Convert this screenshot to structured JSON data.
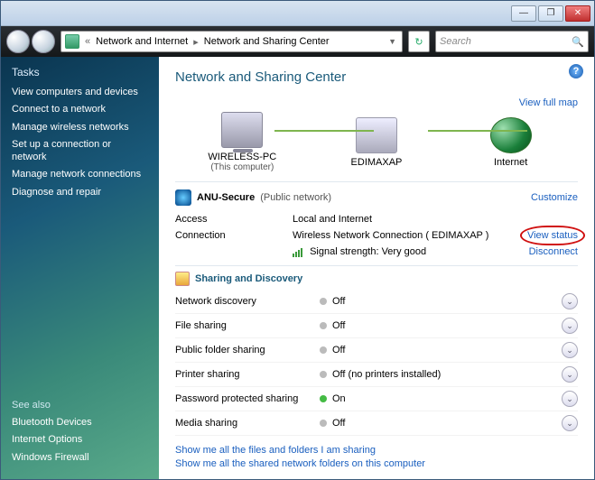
{
  "titlebar": {
    "min": "—",
    "max": "❐",
    "close": "✕"
  },
  "breadcrumb": {
    "prefix": "«",
    "part1": "Network and Internet",
    "part2": "Network and Sharing Center"
  },
  "search": {
    "placeholder": "Search"
  },
  "sidebar": {
    "tasks_head": "Tasks",
    "items": [
      "View computers and devices",
      "Connect to a network",
      "Manage wireless networks",
      "Set up a connection or network",
      "Manage network connections",
      "Diagnose and repair"
    ],
    "seealso_head": "See also",
    "seealso": [
      "Bluetooth Devices",
      "Internet Options",
      "Windows Firewall"
    ]
  },
  "page": {
    "title": "Network and Sharing Center",
    "view_full_map": "View full map",
    "nodes": {
      "pc_name": "WIRELESS-PC",
      "pc_sub": "(This computer)",
      "ap_name": "EDIMAXAP",
      "internet": "Internet"
    }
  },
  "network": {
    "name": "ANU-Secure",
    "type": "(Public network)",
    "customize": "Customize",
    "access_label": "Access",
    "access_value": "Local and Internet",
    "conn_label": "Connection",
    "conn_value": "Wireless Network Connection ( EDIMAXAP )",
    "view_status": "View status",
    "signal_label": "Signal strength:",
    "signal_value": "Very good",
    "disconnect": "Disconnect"
  },
  "sharing": {
    "head": "Sharing and Discovery",
    "rows": [
      {
        "label": "Network discovery",
        "state": "off",
        "text": "Off"
      },
      {
        "label": "File sharing",
        "state": "off",
        "text": "Off"
      },
      {
        "label": "Public folder sharing",
        "state": "off",
        "text": "Off"
      },
      {
        "label": "Printer sharing",
        "state": "off",
        "text": "Off (no printers installed)"
      },
      {
        "label": "Password protected sharing",
        "state": "on",
        "text": "On"
      },
      {
        "label": "Media sharing",
        "state": "off",
        "text": "Off"
      }
    ]
  },
  "footer": {
    "link1": "Show me all the files and folders I am sharing",
    "link2": "Show me all the shared network folders on this computer"
  }
}
